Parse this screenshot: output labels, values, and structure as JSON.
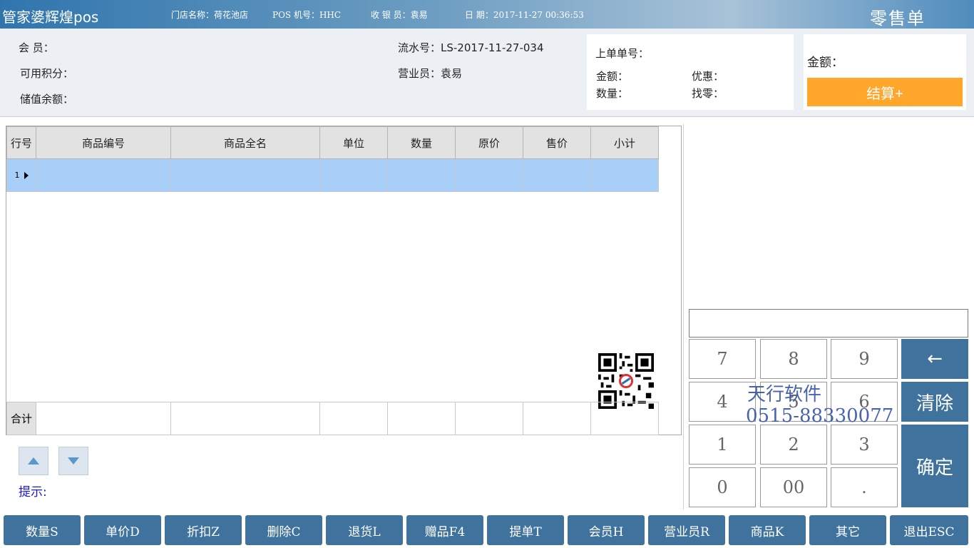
{
  "header": {
    "app_title": "管家婆辉煌pos",
    "store": "门店名称：荷花池店",
    "pos": "POS 机号：HHC",
    "cashier": "收 银 员：袁易",
    "date": "日    期：2017-11-27 00:36:53",
    "doc_type": "零售单"
  },
  "info": {
    "member_label": "会    员：",
    "points_label": "可用积分：",
    "balance_label": "储值余额：",
    "serial_label": "流水号：LS-2017-11-27-034",
    "salesperson_label": "营业员：袁易",
    "prev_order_label": "上单单号：",
    "prev_amount_label": "金额：",
    "prev_discount_label": "优惠：",
    "prev_qty_label": "数量：",
    "prev_change_label": "找零：",
    "amount_label": "金额：",
    "settle_button": "结算+"
  },
  "grid": {
    "headers": [
      "行号",
      "商品编号",
      "商品全名",
      "单位",
      "数量",
      "原价",
      "售价",
      "小计"
    ],
    "rows": [
      {
        "num": "1",
        "cells": [
          "",
          "",
          "",
          "",
          "",
          "",
          ""
        ]
      }
    ],
    "total_label": "合计"
  },
  "hint_label": "提示:",
  "keypad": {
    "keys": [
      "7",
      "8",
      "9",
      "4",
      "5",
      "6",
      "1",
      "2",
      "3",
      "0",
      "00",
      "."
    ],
    "backspace": "←",
    "clear": "清除",
    "confirm": "确定",
    "input_value": ""
  },
  "watermark": {
    "line1": "天行软件",
    "line2": "0515-88330077"
  },
  "toolbar": [
    "数量S",
    "单价D",
    "折扣Z",
    "删除C",
    "退货L",
    "赠品F4",
    "提单T",
    "会员H",
    "营业员R",
    "商品K",
    "其它",
    "退出ESC"
  ],
  "colors": {
    "accent_blue": "#3f729d",
    "settle_orange": "#ffa62b",
    "selected_row": "#a8cff7",
    "hint_text": "#1a1ad6"
  }
}
